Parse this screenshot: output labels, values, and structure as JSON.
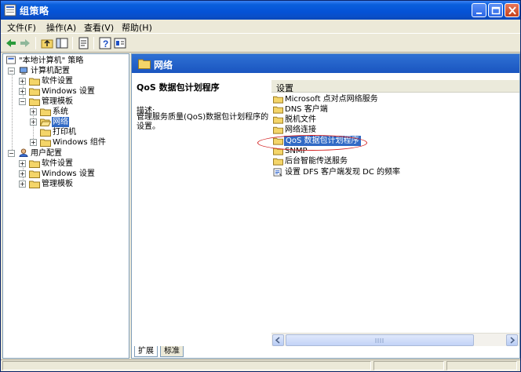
{
  "window": {
    "title": "组策略",
    "minimize_icon": "minimize-icon",
    "maximize_icon": "maximize-icon",
    "close_icon": "close-icon"
  },
  "menu": {
    "file": "文件(F)",
    "action": "操作(A)",
    "view": "查看(V)",
    "help": "帮助(H)"
  },
  "toolbar": {
    "icons": [
      "back-icon",
      "forward-icon",
      "up-folder-icon",
      "show-tree-icon",
      "export-list-icon",
      "help-icon",
      "properties-icon"
    ]
  },
  "tree": {
    "root": "\"本地计算机\" 策略",
    "computer_config": "计算机配置",
    "cc_software": "软件设置",
    "cc_windows": "Windows 设置",
    "cc_admin": "管理模板",
    "cc_system": "系统",
    "cc_network": "网络",
    "cc_printers": "打印机",
    "cc_win_components": "Windows 组件",
    "user_config": "用户配置",
    "uc_software": "软件设置",
    "uc_windows": "Windows 设置",
    "uc_admin": "管理模板"
  },
  "right": {
    "header": "网络",
    "desc_title": "QoS 数据包计划程序",
    "desc_label": "描述:",
    "desc_text": "管理服务质量(QoS)数据包计划程序的设置。",
    "column_header": "设置",
    "rows": [
      "Microsoft 点对点网络服务",
      "DNS 客户端",
      "脱机文件",
      "网络连接",
      "QoS 数据包计划程序",
      "SNMP",
      "后台智能传送服务",
      "设置 DFS 客户端发现 DC 的频率"
    ]
  },
  "tabs": {
    "extended": "扩展",
    "standard": "标准"
  },
  "colors": {
    "selection": "#316ac5",
    "header_blue": "#1a55c0",
    "annotation": "#d21f1f"
  }
}
